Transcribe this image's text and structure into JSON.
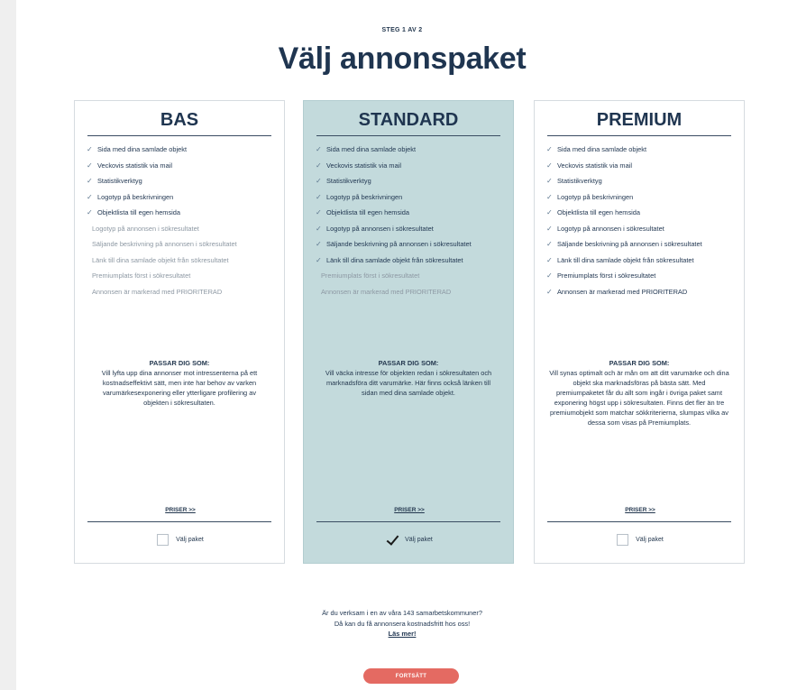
{
  "header": {
    "step": "STEG 1 AV 2",
    "title": "Välj annonspaket"
  },
  "packages": [
    {
      "name": "BAS",
      "selected": false,
      "features_on": [
        "Sida med dina samlade objekt",
        "Veckovis statistik via mail",
        "Statistikverktyg",
        "Logotyp på beskrivningen",
        "Objektlista till egen hemsida"
      ],
      "features_off": [
        "Logotyp på annonsen i sökresultatet",
        "Säljande beskrivning på annonsen i sökresultatet",
        "Länk till dina samlade objekt från sökresultatet",
        "Premiumplats först i sökresultatet",
        "Annonsen är markerad med PRIORITERAD"
      ],
      "fit_heading": "PASSAR DIG SOM:",
      "fit_text": "Vill lyfta upp dina annonser mot intressenterna på ett kostnadseffektivt sätt, men inte har behov av varken varumärkesexponering eller ytterligare profilering av objekten i sökresultaten.",
      "prices_link": "PRISER >>",
      "choose_label": "Välj paket"
    },
    {
      "name": "STANDARD",
      "selected": true,
      "features_on": [
        "Sida med dina samlade objekt",
        "Veckovis statistik via mail",
        "Statistikverktyg",
        "Logotyp på beskrivningen",
        "Objektlista till egen hemsida",
        "Logotyp på annonsen i sökresultatet",
        "Säljande beskrivning på annonsen i sökresultatet",
        "Länk till dina samlade objekt från sökresultatet"
      ],
      "features_off": [
        "Premiumplats först i sökresultatet",
        "Annonsen är markerad med PRIORITERAD"
      ],
      "fit_heading": "PASSAR DIG SOM:",
      "fit_text": "Vill väcka intresse för objekten redan i sökresultaten och marknadsföra ditt varumärke. Här finns också länken till sidan med dina samlade objekt.",
      "prices_link": "PRISER >>",
      "choose_label": "Välj paket"
    },
    {
      "name": "PREMIUM",
      "selected": false,
      "features_on": [
        "Sida med dina samlade objekt",
        "Veckovis statistik via mail",
        "Statistikverktyg",
        "Logotyp på beskrivningen",
        "Objektlista till egen hemsida",
        "Logotyp på annonsen i sökresultatet",
        "Säljande beskrivning på annonsen i sökresultatet",
        "Länk till dina samlade objekt från sökresultatet",
        "Premiumplats först i sökresultatet",
        "Annonsen är markerad med PRIORITERAD"
      ],
      "features_off": [],
      "fit_heading": "PASSAR DIG SOM:",
      "fit_text": "Vill synas optimalt och är mån om att ditt varumärke och dina objekt ska marknadsföras på bästa sätt. Med premiumpaketet får du allt som ingår i övriga paket samt exponering högst upp i sökresultaten. Finns det fler än tre premiumobjekt som matchar sökkriterierna, slumpas vilka av dessa som visas på Premiumplats.",
      "prices_link": "PRISER >>",
      "choose_label": "Välj paket"
    }
  ],
  "promo": {
    "line1": "Är du verksam i en av våra 143 samarbetskommuner?",
    "line2": "Då kan du få annonsera kostnadsfritt hos oss!",
    "link": "Läs mer!"
  },
  "cta": {
    "label": "FORTSÄTT"
  },
  "colors": {
    "navy": "#1f3550",
    "selected_bg": "#c3dadc",
    "cta": "#e46a62"
  },
  "icons": {
    "feature_included": "check-icon",
    "selected_checkbox": "checkmark-icon"
  }
}
